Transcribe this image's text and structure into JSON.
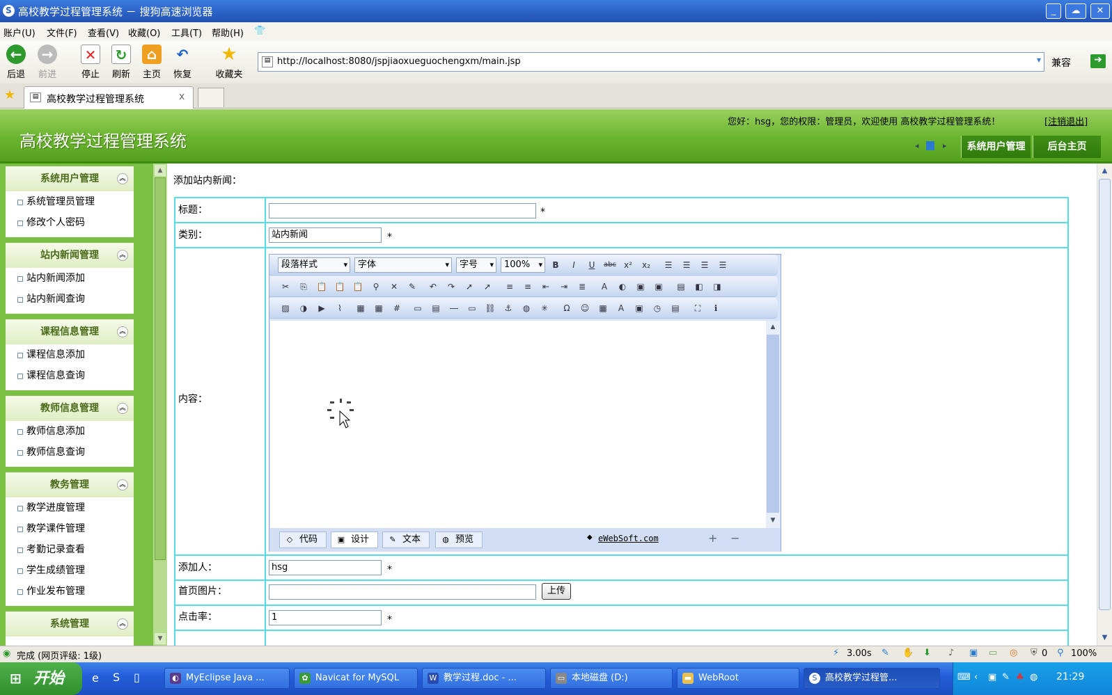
{
  "window": {
    "title": "高校教学过程管理系统 － 搜狗高速浏览器"
  },
  "menubar": {
    "items": [
      "账户(U)",
      "文件(F)",
      "查看(V)",
      "收藏(O)",
      "工具(T)",
      "帮助(H)"
    ]
  },
  "toolbar": {
    "back": "后退",
    "forward": "前进",
    "stop": "停止",
    "refresh": "刷新",
    "home": "主页",
    "restore": "恢复",
    "favorites": "收藏夹",
    "url": "http://localhost:8080/jspjiaoxueguochengxm/main.jsp",
    "compat": "兼容"
  },
  "tabs": {
    "active": "高校教学过程管理系统",
    "close": "x"
  },
  "header": {
    "title": "高校教学过程管理系统",
    "welcome": "您好：hsg，您的权限：管理员，欢迎使用 高校教学过程管理系统！",
    "logout": "[注销退出]",
    "btn_user": "系统用户管理",
    "btn_home": "后台主页"
  },
  "sidebar": {
    "groups": [
      {
        "title": "系统用户管理",
        "items": [
          "系统管理员管理",
          "修改个人密码"
        ]
      },
      {
        "title": "站内新闻管理",
        "items": [
          "站内新闻添加",
          "站内新闻查询"
        ]
      },
      {
        "title": "课程信息管理",
        "items": [
          "课程信息添加",
          "课程信息查询"
        ]
      },
      {
        "title": "教师信息管理",
        "items": [
          "教师信息添加",
          "教师信息查询"
        ]
      },
      {
        "title": "教务管理",
        "items": [
          "教学进度管理",
          "教学课件管理",
          "考勤记录查看",
          "学生成绩管理",
          "作业发布管理"
        ]
      },
      {
        "title": "系统管理",
        "items": []
      }
    ]
  },
  "form": {
    "heading": "添加站内新闻：",
    "title_label": "标题：",
    "title_value": "",
    "category_label": "类别：",
    "category_value": "站内新闻",
    "content_label": "内容：",
    "author_label": "添加人：",
    "author_value": "hsg",
    "image_label": "首页图片：",
    "image_value": "",
    "upload": "上传",
    "clicks_label": "点击率：",
    "clicks_value": "1",
    "required": "*"
  },
  "editor": {
    "style_select": "段落样式",
    "font_select": "字体",
    "size_select": "字号",
    "zoom_select": "100%",
    "tab_code": "代码",
    "tab_design": "设计",
    "tab_text": "文本",
    "tab_preview": "预览",
    "brand": "eWebSoft.com"
  },
  "statusbar": {
    "text": "完成 (网页评级: 1级)",
    "speed": "3.00s",
    "count": "0",
    "zoom": "100%"
  },
  "taskbar": {
    "start": "开始",
    "tasks": [
      "MyEclipse Java ...",
      "Navicat for MySQL",
      "教学过程.doc - ...",
      "本地磁盘 (D:)",
      "WebRoot",
      "高校教学过程管..."
    ],
    "time": "21:29"
  }
}
